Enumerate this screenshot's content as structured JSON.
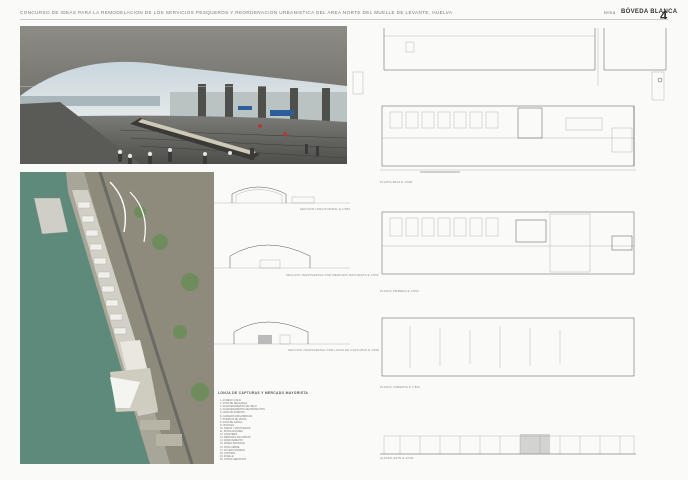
{
  "header": {
    "title": "CONCURSO DE IDEAS PARA LA REMODELACION DE LOS SERVICIOS PESQUEROS Y REORDENACION URBANISTICA DEL AREA NORTE DEL MUELLE DE LEVANTE, HUELVA",
    "lema_label": "lema",
    "lema": "BÓVEDA BLANCA",
    "sheet_number": "4"
  },
  "colors": {
    "water": "#5d8a7a",
    "vault": "#bdbab2",
    "plan_line": "#555555",
    "background": "#fafaf8"
  },
  "icons": [
    "north-arrow-icon",
    "scale-bar-icon"
  ],
  "legend": {
    "title": "LONJA DE CAPTURAS Y MERCADO MAYORISTA",
    "items": [
      "1. ACCESO LONJA",
      "2. ZONA DE DESCARGA",
      "3. ALMACENAMIENTO DE HIELO",
      "4. ALMACENAMIENTO DE PRODUCTOS",
      "5. NAVE DE SUBASTA",
      "6. CAMARAS FRIGORIFICAS",
      "7. PUESTOS DE VENTA",
      "8. ZONA DE CARGA",
      "9. OFICINAS",
      "10. ASEOS Y VESTUARIOS",
      "11. INSTALACIONES",
      "12. CAFETERIA",
      "13. MERCADO MAYORISTA",
      "14. APARCAMIENTO",
      "15. PASEO PEATONAL",
      "16. ZONA VERDE",
      "17. ACCESO RODADO",
      "18. CONTROL",
      "19. MUELLE",
      "20. OTROS SERVICIOS"
    ]
  },
  "sections": {
    "s1": "SECCION LONGITUDINAL E 1/500",
    "s2": "SECCION TRANSVERSAL POR MERCADO MAYORISTA E 1/500",
    "s3": "SECCION TRANSVERSAL POR LONJA DE CAPTURAS E 1/500"
  },
  "plans": {
    "p1": "PLANTA BAJA E 1/500",
    "p2": "PLANTA PRIMERA E 1/500",
    "p3": "PLANTA CUBIERTA E 1/500",
    "p4": "ALZADO ESTE E 1/500"
  }
}
